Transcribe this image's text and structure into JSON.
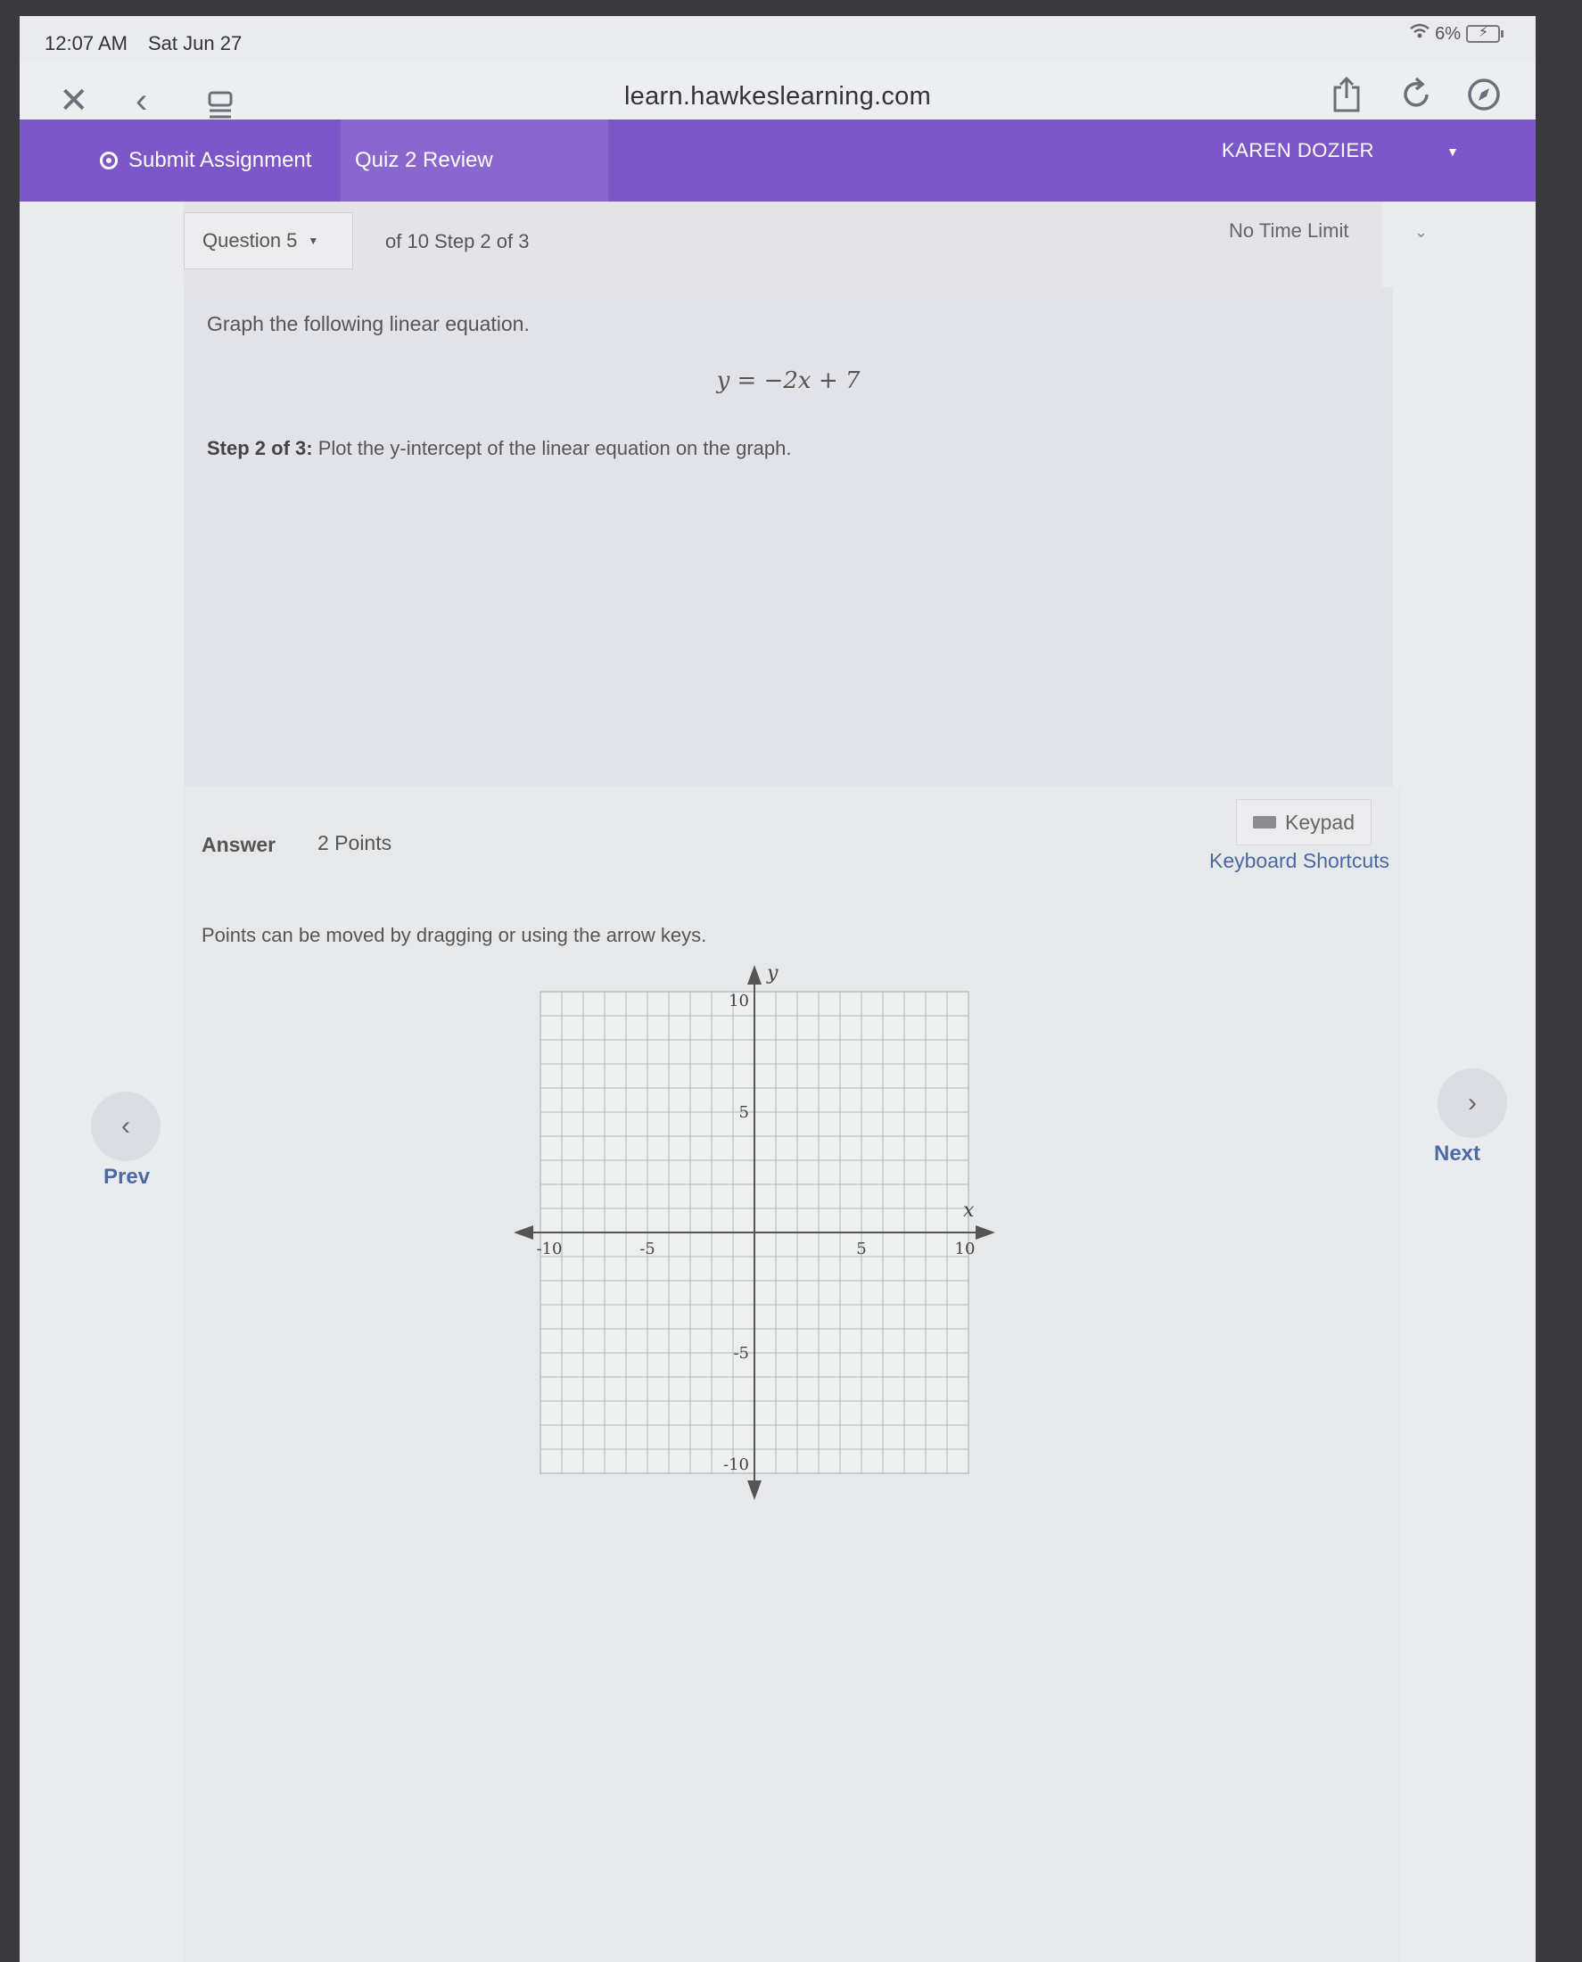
{
  "status_bar": {
    "time": "12:07 AM",
    "date": "Sat Jun 27",
    "wifi_icon": "wifi-icon",
    "battery": "6%"
  },
  "browser": {
    "url": "learn.hawkeslearning.com",
    "close_icon": "close-icon",
    "back_icon": "back-icon",
    "reader_icon": "reader-icon",
    "share_icon": "share-icon",
    "reload_icon": "reload-icon",
    "compass_icon": "compass-icon"
  },
  "nav": {
    "submit_label": "Submit Assignment",
    "quiz_title": "Quiz 2 Review",
    "user_name": "KAREN DOZIER",
    "accent_color": "#7d56c7"
  },
  "question": {
    "selector_label": "Question 5",
    "step_info": "of 10 Step 2 of 3",
    "time_limit": "No Time Limit",
    "prompt": "Graph the following linear equation.",
    "equation": "y = −2x + 7",
    "step_bold": "Step 2 of 3:",
    "step_text": " Plot the y-intercept of the linear equation on the graph."
  },
  "answer": {
    "label": "Answer",
    "points": "2 Points",
    "keypad_label": "Keypad",
    "shortcuts_label": "Keyboard Shortcuts",
    "hint": "Points can be moved by dragging or using the arrow keys."
  },
  "graph": {
    "x_axis_label": "x",
    "y_axis_label": "y",
    "x_range": [
      -10,
      10
    ],
    "y_range": [
      -10,
      10
    ],
    "x_ticks": [
      "-10",
      "-5",
      "5",
      "10"
    ],
    "y_ticks": [
      "10",
      "5",
      "-5",
      "-10"
    ]
  },
  "pager": {
    "prev_label": "Prev",
    "next_label": "Next"
  }
}
